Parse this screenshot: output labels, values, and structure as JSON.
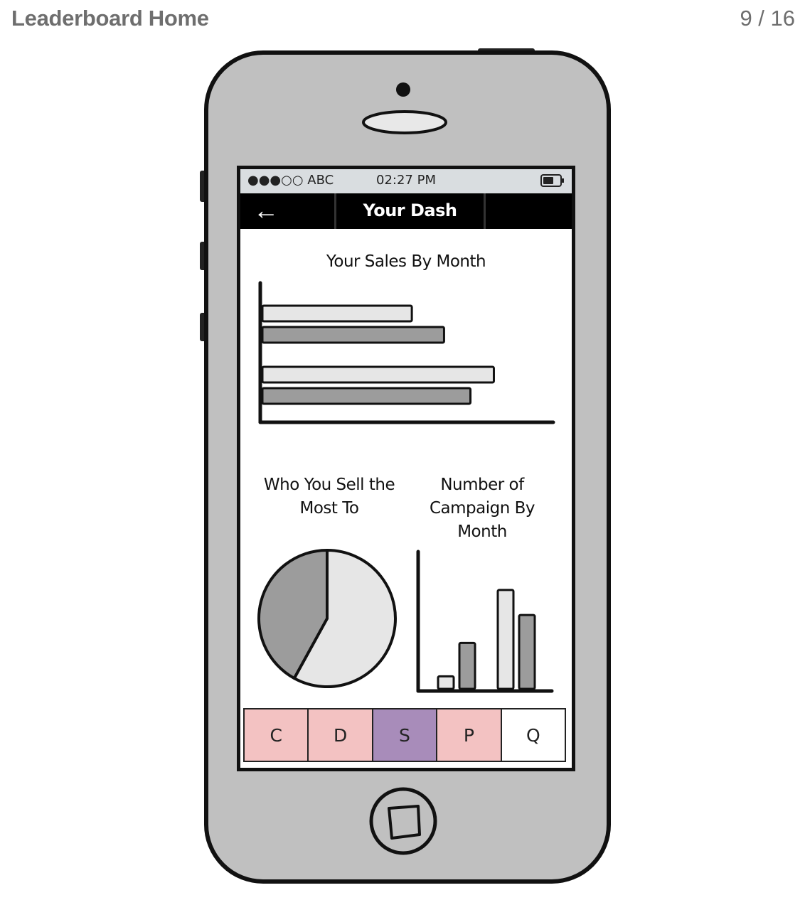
{
  "header": {
    "title": "Leaderboard Home",
    "page_counter": "9 / 16"
  },
  "status_bar": {
    "carrier": "●●●○○ ABC",
    "time": "02:27 PM",
    "battery_icon": "battery-icon"
  },
  "nav_bar": {
    "back_icon": "←",
    "title": "Your Dash"
  },
  "colors": {
    "phone_body": "#c0c0c0",
    "screen": "#ffffff",
    "bar_light": "#e6e6e6",
    "bar_dark": "#9c9c9c",
    "tab_pink": "#f3c2c2",
    "tab_purple": "#a88cba",
    "tab_white": "#ffffff"
  },
  "tabs": [
    {
      "label": "C",
      "color": "#f3c2c2"
    },
    {
      "label": "D",
      "color": "#f3c2c2"
    },
    {
      "label": "S",
      "color": "#a88cba"
    },
    {
      "label": "P",
      "color": "#f3c2c2"
    },
    {
      "label": "Q",
      "color": "#ffffff"
    }
  ],
  "chart_data": [
    {
      "type": "bar",
      "orientation": "horizontal",
      "title": "Your Sales By Month",
      "categories": [
        "",
        ""
      ],
      "series": [
        {
          "values": [
            51,
            79
          ],
          "color": "#e6e6e6"
        },
        {
          "values": [
            62,
            71
          ],
          "color": "#9c9c9c"
        }
      ],
      "xlim": [
        0,
        100
      ],
      "grid": false
    },
    {
      "type": "pie",
      "title": "Who You Sell the Most To",
      "values": [
        58,
        42
      ],
      "colors": [
        "#e6e6e6",
        "#9c9c9c"
      ]
    },
    {
      "type": "bar",
      "title": "Number of Campaign By Month",
      "categories": [
        "",
        ""
      ],
      "series": [
        {
          "values": [
            9,
            71
          ],
          "color": "#e6e6e6"
        },
        {
          "values": [
            33,
            53
          ],
          "color": "#9c9c9c"
        }
      ],
      "ylim": [
        0,
        100
      ],
      "grid": false
    }
  ]
}
